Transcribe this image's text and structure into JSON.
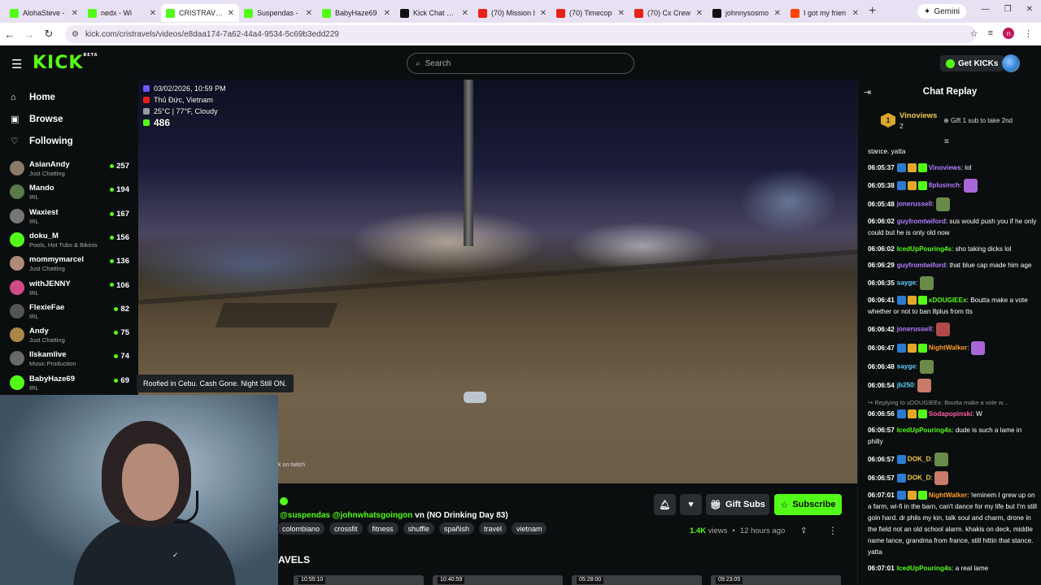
{
  "browser": {
    "tabs": [
      {
        "title": "AlohaSteve -",
        "color": "#53fc18",
        "active": false
      },
      {
        "title": "nedx - Wi",
        "color": "#53fc18",
        "active": false
      },
      {
        "title": "CRISTRAVELS",
        "color": "#53fc18",
        "active": true
      },
      {
        "title": "Suspendas - ",
        "color": "#53fc18",
        "active": false
      },
      {
        "title": "BabyHaze69",
        "color": "#53fc18",
        "active": false
      },
      {
        "title": "Kick Chat Sear",
        "color": "#111111",
        "active": false
      },
      {
        "title": "(70) Mission I",
        "color": "#e62117",
        "active": false
      },
      {
        "title": "(70) Timecop",
        "color": "#e62117",
        "active": false
      },
      {
        "title": "(70) Cx Crew",
        "color": "#e62117",
        "active": false
      },
      {
        "title": "johnnysosmo",
        "color": "#111111",
        "active": false
      },
      {
        "title": "I got my frien",
        "color": "#ff4500",
        "active": false
      }
    ],
    "gemini_label": "Gemini",
    "url": "kick.com/cristravels/videos/e8daa174-7a62-44a4-9534-5c69b3edd229",
    "profile_initial": "n"
  },
  "header": {
    "logo": "KICK",
    "logo_tag": "BETA",
    "search_placeholder": "Search",
    "get_kicks": "Get KICKs"
  },
  "sidebar": {
    "nav": [
      {
        "label": "Home",
        "icon": "home-icon"
      },
      {
        "label": "Browse",
        "icon": "browse-icon"
      },
      {
        "label": "Following",
        "icon": "heart-icon"
      }
    ],
    "channels": [
      {
        "name": "AsianAndy",
        "category": "Just Chatting",
        "viewers": "257",
        "color": "#8a7a6a"
      },
      {
        "name": "Mando",
        "category": "IRL",
        "viewers": "194",
        "color": "#5a7a4a"
      },
      {
        "name": "Waxiest",
        "category": "IRL",
        "viewers": "167",
        "color": "#777777"
      },
      {
        "name": "doku_M",
        "category": "Pools, Hot Tubs & Bikinis",
        "viewers": "156",
        "color": "#53fc18"
      },
      {
        "name": "mommymarcel",
        "category": "Just Chatting",
        "viewers": "136",
        "color": "#b08a7a"
      },
      {
        "name": "withJENNY",
        "category": "IRL",
        "viewers": "106",
        "color": "#d04a8a"
      },
      {
        "name": "FlexieFae",
        "category": "IRL",
        "viewers": "82",
        "color": "#555555"
      },
      {
        "name": "Andy",
        "category": "Just Chatting",
        "viewers": "75",
        "color": "#aa8844"
      },
      {
        "name": "Ilskamlive",
        "category": "Music Production",
        "viewers": "74",
        "color": "#6a6a6a"
      },
      {
        "name": "BabyHaze69",
        "category": "IRL",
        "viewers": "69",
        "color": "#53fc18"
      }
    ]
  },
  "video": {
    "overlay_datetime": "03/02/2026, 10:59 PM",
    "overlay_location": "Thủ Đức, Vietnam",
    "overlay_weather": "25°C | 77°F, Cloudy",
    "overlay_viewers": "486",
    "caption": "Roofied in Cebu. Cash Gone. Night Still ON.",
    "twitch_note": "k on twitch"
  },
  "details": {
    "title_mentions": "@suspendas @johnwhatsgoingon",
    "title_rest": " vn (NO Drinking Day 83)",
    "tags": [
      "colombiano",
      "crossfit",
      "fitness",
      "shuffle",
      "spañish",
      "travel",
      "vietnam"
    ],
    "gift_label": "Gift Subs",
    "subscribe_label": "Subscribe",
    "views": "1.4K",
    "views_word": "views",
    "age": "12 hours ago",
    "section_title": "AVELS",
    "thumbs": [
      "10:55:10",
      "10:40:59",
      "05:28:00",
      "09:23:05"
    ]
  },
  "chat": {
    "title": "Chat Replay",
    "pinned": {
      "rank": "1",
      "name": "Vinoviews",
      "count": "2",
      "note": "Gift 1 sub to take 2nd"
    },
    "messages": [
      {
        "time": "",
        "user": "",
        "color": "#ffffff",
        "text": "stance. yatta",
        "badges": 0,
        "emote": false
      },
      {
        "time": "06:05:37",
        "user": "Vinoviews",
        "color": "#b47cff",
        "text": "lol",
        "badges": 3,
        "emote": false
      },
      {
        "time": "06:05:38",
        "user": "8plusinch",
        "color": "#b47cff",
        "text": "",
        "badges": 3,
        "emote": true
      },
      {
        "time": "06:05:48",
        "user": "jonerussell",
        "color": "#b47cff",
        "text": "",
        "badges": 0,
        "emote": true
      },
      {
        "time": "06:06:02",
        "user": "guyfromtwiford",
        "color": "#b47cff",
        "text": "sus would push you if he only could but he is only old now",
        "badges": 0,
        "emote": false
      },
      {
        "time": "06:06:02",
        "user": "IcedUpPouring4s",
        "color": "#53fc18",
        "text": "sho taking dicks lol",
        "badges": 0,
        "emote": false
      },
      {
        "time": "06:06:29",
        "user": "guyfromtwiford",
        "color": "#b47cff",
        "text": "that blue cap made him age",
        "badges": 0,
        "emote": false
      },
      {
        "time": "06:06:35",
        "user": "sayge",
        "color": "#5fd0ff",
        "text": "",
        "badges": 0,
        "emote": true
      },
      {
        "time": "06:06:41",
        "user": "xDOUGIEEx",
        "color": "#53fc18",
        "text": "Boutta make a vote whether or not to ban 8plus from tts",
        "badges": 3,
        "emote": false
      },
      {
        "time": "06:06:42",
        "user": "jonerussell",
        "color": "#b47cff",
        "text": "",
        "badges": 0,
        "emote": true
      },
      {
        "time": "06:06:47",
        "user": "NightWalker",
        "color": "#ff9d2b",
        "text": "",
        "badges": 3,
        "emote": true
      },
      {
        "time": "06:06:48",
        "user": "sayge",
        "color": "#5fd0ff",
        "text": "",
        "badges": 0,
        "emote": true
      },
      {
        "time": "06:06:54",
        "user": "jb250",
        "color": "#5fd0ff",
        "text": "",
        "badges": 0,
        "emote": true
      },
      {
        "time": "06:06:56",
        "user": "Sodapopinski",
        "color": "#ff5fa2",
        "text": "W",
        "badges": 3,
        "emote": false,
        "reply": "Replying to xDOUGIEEx: Boutta make a vote w..."
      },
      {
        "time": "06:06:57",
        "user": "IcedUpPouring4s",
        "color": "#53fc18",
        "text": "dude is such a lame in philly",
        "badges": 0,
        "emote": false
      },
      {
        "time": "06:06:57",
        "user": "DOK_D",
        "color": "#f2c84b",
        "text": "",
        "badges": 1,
        "emote": true
      },
      {
        "time": "06:06:57",
        "user": "DOK_D",
        "color": "#f2c84b",
        "text": "",
        "badges": 1,
        "emote": true
      },
      {
        "time": "06:07:01",
        "user": "NightWalker",
        "color": "#ff9d2b",
        "text": "!eminem I grew up on a farm, wi-fi in the barn, can't dance for my life but I'm still goin hard. dr phils my kin, talk soul and charm, drone in the field not an old school alarm. khakis on deck, middle name lance, grandma from france, still hittin that stance. yatta",
        "badges": 3,
        "emote": false
      },
      {
        "time": "06:07:01",
        "user": "IcedUpPouring4s",
        "color": "#53fc18",
        "text": "a real lame",
        "badges": 0,
        "emote": false
      }
    ]
  }
}
